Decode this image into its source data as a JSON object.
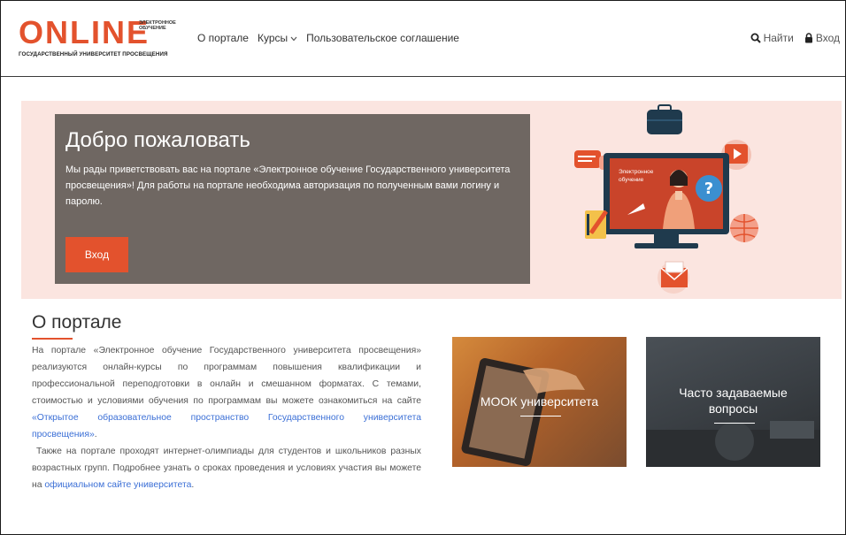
{
  "header": {
    "logo": {
      "word": "ONLINE",
      "sub_line1": "ЭЛЕКТРОННОЕ",
      "sub_line2": "ОБУЧЕНИЕ",
      "tagline": "ГОСУДАРСТВЕННЫЙ УНИВЕРСИТЕТ ПРОСВЕЩЕНИЯ"
    },
    "nav": [
      {
        "label": "О портале"
      },
      {
        "label": "Курсы"
      },
      {
        "label": "Пользовательское соглашение"
      }
    ],
    "search_label": "Найти",
    "login_label": "Вход"
  },
  "hero": {
    "title": "Добро пожаловать",
    "text": "Мы рады приветствовать вас на портале «Электронное обучение Государственного университета просвещения»! Для работы на портале необходима авторизация по полученным вами логину и паролю.",
    "button_label": "Вход",
    "illustration_screen_text": "Электронное обучение"
  },
  "about": {
    "title": "О портале",
    "p1_a": "На портале «Электронное обучение Государственного университета просвещения» реализуются онлайн-курсы по программам повышения квалификации и профессиональной переподготовки в онлайн и смешанном форматах. С темами, стоимостью и условиями обучения по программам вы можете ознакомиться на сайте ",
    "p1_link": "«Открытое образовательное пространство Государственного университета просвещения»",
    "p1_end": ".",
    "p2_a": "Также на портале проходят интернет-олимпиады для студентов и школьников разных возрастных групп. Подробнее узнать о сроках проведения и условиях участия вы можете на ",
    "p2_link": "официальном сайте университета",
    "p2_end": "."
  },
  "cards": {
    "mook": "МООК университета",
    "faq_line1": "Часто задаваемые",
    "faq_line2": "вопросы"
  },
  "colors": {
    "accent": "#e3522d",
    "hero_bg": "#fbe5e0",
    "welcome_bg": "#6f6762",
    "link": "#3b6fd6"
  }
}
